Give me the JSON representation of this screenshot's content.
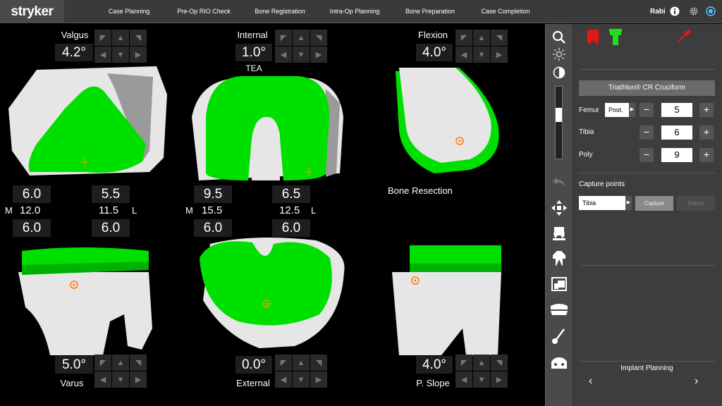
{
  "header": {
    "logo": "stryker",
    "tabs": [
      "Case Planning",
      "Pre-Op RIO Check",
      "Bone Registration",
      "Intra-Op Planning",
      "Bone Preparation",
      "Case Completion"
    ],
    "user": "Rabi"
  },
  "viewport": {
    "femur_front": {
      "label": "Valgus",
      "value": "4.2°"
    },
    "femur_axial": {
      "label": "Internal",
      "value": "1.0°",
      "sublabel": "TEA"
    },
    "femur_side": {
      "label": "Flexion",
      "value": "4.0°"
    },
    "tibia_front": {
      "label": "Varus",
      "value": "5.0°"
    },
    "tibia_axial": {
      "label": "External",
      "value": "0.0°"
    },
    "tibia_side": {
      "label": "P. Slope",
      "value": "4.0°"
    },
    "bone_resection_label": "Bone Resection",
    "gaps_left": {
      "top_m": "6.0",
      "top_l": "5.5",
      "mid_m": "12.0",
      "mid_l": "11.5",
      "bot_m": "6.0",
      "bot_l": "6.0",
      "m": "M",
      "l": "L"
    },
    "gaps_right": {
      "top_m": "9.5",
      "top_l": "6.5",
      "mid_m": "15.5",
      "mid_l": "12.5",
      "bot_m": "6.0",
      "bot_l": "6.0",
      "m": "M",
      "l": "L"
    },
    "colors": {
      "implant": "#00e000",
      "bone": "#e6e6e6",
      "target": "#ff7a00"
    }
  },
  "toolbar": {
    "tools": [
      "search-icon",
      "brightness-icon",
      "contrast-icon",
      "slider",
      "undo-icon",
      "move-icon",
      "femur-view-icon",
      "tibia-view-icon",
      "screen-capture-icon",
      "implant-view-icon",
      "probe-icon",
      "robot-icon"
    ]
  },
  "panel": {
    "implant_name": "Triathlon® CR Cruciform",
    "femur": {
      "label": "Femur",
      "option": "Post.",
      "value": "5"
    },
    "tibia": {
      "label": "Tibia",
      "value": "6"
    },
    "poly": {
      "label": "Poly",
      "value": "9"
    },
    "capture_title": "Capture points",
    "capture_select": "Tibia",
    "capture_button": "Capture",
    "delete_button": "Delete",
    "footer_title": "Implant Planning",
    "accent_red": "#e01818",
    "accent_green": "#22dd22"
  }
}
